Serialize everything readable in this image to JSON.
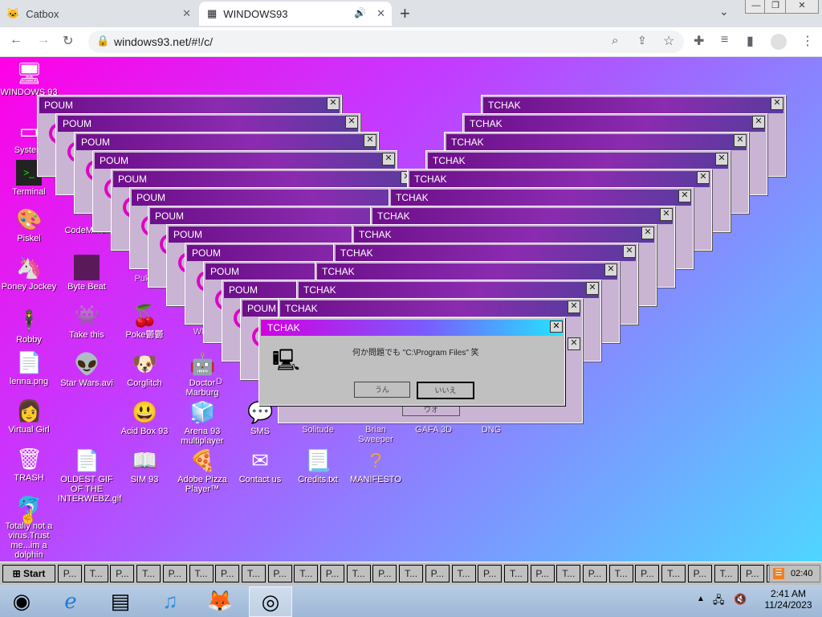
{
  "browser": {
    "tabs": [
      {
        "title": "Catbox"
      },
      {
        "title": "WINDOWS93"
      }
    ],
    "url": "windows93.net/#!/c/"
  },
  "desktop_icons": [
    {
      "label": "WINDOWS 93",
      "icon": "computer-icon"
    },
    {
      "label": "System",
      "icon": "system-icon"
    },
    {
      "label": "Terminal",
      "icon": "terminal-icon"
    },
    {
      "label": "Piskel",
      "icon": "palette-icon"
    },
    {
      "label": "Poney Jockey",
      "icon": "pony-icon"
    },
    {
      "label": "Robby",
      "icon": "stickman-icon"
    },
    {
      "label": "lenna.png",
      "icon": "image-file-icon"
    },
    {
      "label": "Virtual Girl",
      "icon": "girl-icon"
    },
    {
      "label": "TRASH",
      "icon": "trash-icon"
    },
    {
      "label": "Totally not a virus.Trust me...im a dolphin",
      "icon": "dolphin-icon"
    },
    {
      "label": "CodeMirror",
      "icon": "code-icon"
    },
    {
      "label": "Byte Beat",
      "icon": "bytebeat-icon"
    },
    {
      "label": "Take this",
      "icon": "take-this-icon"
    },
    {
      "label": "Star Wars.avi",
      "icon": "yoda-icon"
    },
    {
      "label": "OLDEST GIF OF THE INTERWEBZ.gif",
      "icon": "gif-file-icon"
    },
    {
      "label": "Puke",
      "icon": "puke-icon"
    },
    {
      "label": "Poke鬱鬱",
      "icon": "poke-icon"
    },
    {
      "label": "Corglitch",
      "icon": "corgi-icon"
    },
    {
      "label": "Acid Box 93",
      "icon": "smiley-icon"
    },
    {
      "label": "SIM 93",
      "icon": "sim-icon"
    },
    {
      "label": "Wha",
      "icon": "generic-icon"
    },
    {
      "label": "Doctor Marburg",
      "icon": "doctor-icon"
    },
    {
      "label": "Arena 93 multiplayer",
      "icon": "cube-icon"
    },
    {
      "label": "Adobe Pizza Player™",
      "icon": "pizza-icon"
    },
    {
      "label": "D",
      "icon": "generic-icon"
    },
    {
      "label": "SMS",
      "icon": "sms-icon"
    },
    {
      "label": "Contact us",
      "icon": "contact-icon"
    },
    {
      "label": "Solitude",
      "icon": "solitude-icon"
    },
    {
      "label": "Credits.txt",
      "icon": "text-file-icon"
    },
    {
      "label": "Brian Sweeper",
      "icon": "sweeper-icon"
    },
    {
      "label": "MANIFESTO",
      "icon": "question-icon"
    },
    {
      "label": "GAFA 3D",
      "icon": "gafa-icon"
    },
    {
      "label": "DNG",
      "icon": "dng-icon"
    }
  ],
  "windows": {
    "poum_title": "POUM",
    "tchak_title": "TCHAK",
    "dialog": {
      "title": "TCHAK",
      "message": "何か問題でも \"C:\\Program Files\" 笑",
      "button_yes": "うん",
      "button_no": "いいえ",
      "button_behind": "ワオ"
    }
  },
  "win93_taskbar": {
    "start_label": "Start",
    "task_labels": [
      "P...",
      "T...",
      "P...",
      "T...",
      "P...",
      "T...",
      "P...",
      "T...",
      "P...",
      "T...",
      "P...",
      "T...",
      "P...",
      "T...",
      "P...",
      "T...",
      "P...",
      "T...",
      "P...",
      "T...",
      "P...",
      "T...",
      "P...",
      "T...",
      "P...",
      "T...",
      "P...",
      "T...",
      "T..."
    ],
    "clock": "02:40"
  },
  "win7_taskbar": {
    "pinned": [
      {
        "icon": "start-orb-icon"
      },
      {
        "icon": "internet-explorer-icon"
      },
      {
        "icon": "media-center-icon"
      },
      {
        "icon": "itunes-icon"
      },
      {
        "icon": "firefox-icon"
      },
      {
        "icon": "chrome-icon"
      }
    ],
    "time": "2:41 AM",
    "date": "11/24/2023"
  }
}
